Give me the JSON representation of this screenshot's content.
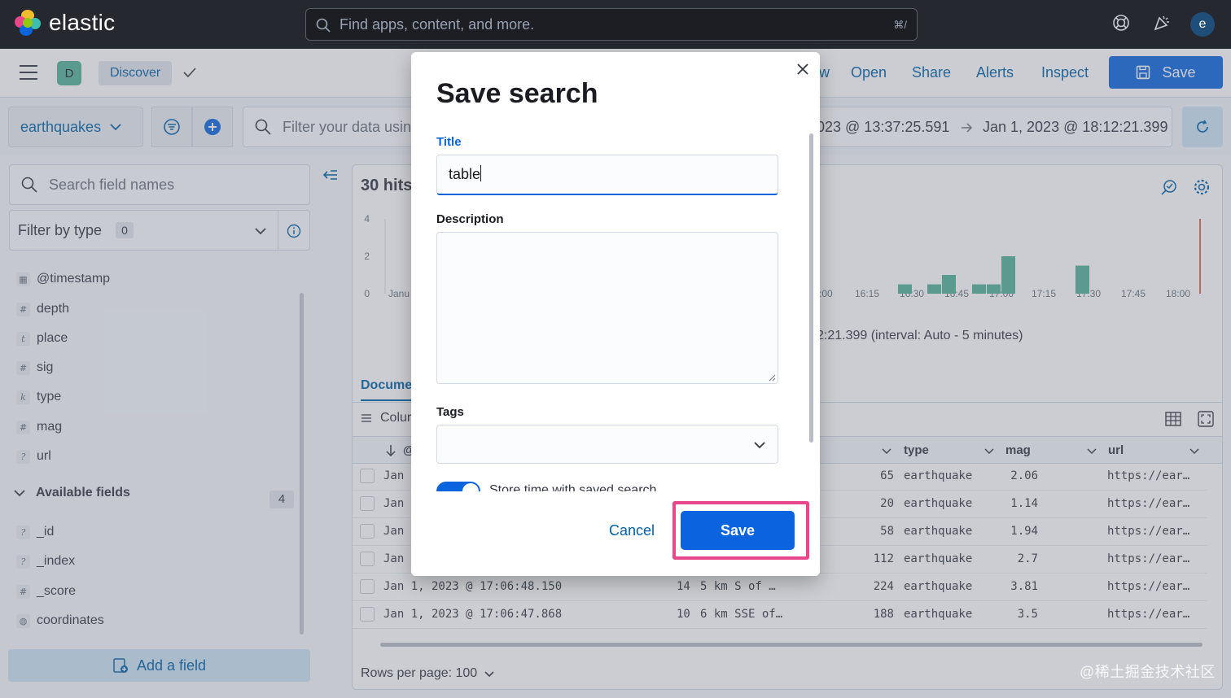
{
  "header": {
    "brand": "elastic",
    "search_placeholder": "Find apps, content, and more.",
    "search_shortcut": "⌘/",
    "avatar_initial": "e"
  },
  "appbar": {
    "space_initial": "D",
    "breadcrumb": "Discover",
    "menu": [
      "w",
      "Open",
      "Share",
      "Alerts",
      "Inspect"
    ],
    "save_label": "Save"
  },
  "querybar": {
    "data_view": "earthquakes",
    "filter_placeholder": "Filter your data usin",
    "date_start": "023 @ 13:37:25.591",
    "date_end": "Jan 1, 2023 @ 18:12:21.399"
  },
  "sidebar": {
    "search_placeholder": "Search field names",
    "filter_by_type": "Filter by type",
    "filter_count": "0",
    "selected_fields": [
      {
        "name": "@timestamp",
        "type": "date"
      },
      {
        "name": "depth",
        "type": "#"
      },
      {
        "name": "place",
        "type": "t"
      },
      {
        "name": "sig",
        "type": "#"
      },
      {
        "name": "type",
        "type": "k"
      },
      {
        "name": "mag",
        "type": "#"
      },
      {
        "name": "url",
        "type": "?"
      }
    ],
    "available_label": "Available fields",
    "available_count": "4",
    "available_fields": [
      {
        "name": "_id",
        "type": "?"
      },
      {
        "name": "_index",
        "type": "?"
      },
      {
        "name": "_score",
        "type": "#"
      },
      {
        "name": "coordinates",
        "type": "geo"
      }
    ],
    "add_field": "Add a field"
  },
  "main": {
    "hits": "30 hits",
    "interval_text": "2:21.399 (interval: Auto - 5 minutes)",
    "tab_documents": "Docume",
    "columns_label": "Colur",
    "grid_headers": [
      "type",
      "mag",
      "url"
    ],
    "rows_per_page": "Rows per page: 100",
    "rows": [
      {
        "ts": "Jan",
        "place": "",
        "sig": "65",
        "type": "earthquake",
        "mag": "2.06",
        "url": "https://ear…"
      },
      {
        "ts": "Jan",
        "place": "",
        "sig": "20",
        "type": "earthquake",
        "mag": "1.14",
        "url": "https://ear…"
      },
      {
        "ts": "Jan",
        "place": "",
        "sig": "58",
        "type": "earthquake",
        "mag": "1.94",
        "url": "https://ear…"
      },
      {
        "ts": "Jan",
        "place": "",
        "sig": "112",
        "type": "earthquake",
        "mag": "2.7",
        "url": "https://ear…"
      },
      {
        "ts": "Jan 1, 2023 @ 17:06:48.150",
        "depth": "14",
        "place": "5 km S of …",
        "sig": "224",
        "type": "earthquake",
        "mag": "3.81",
        "url": "https://ear…"
      },
      {
        "ts": "Jan 1, 2023 @ 17:06:47.868",
        "depth": "10",
        "place": "6 km SSE of…",
        "sig": "188",
        "type": "earthquake",
        "mag": "3.5",
        "url": "https://ear…"
      }
    ]
  },
  "chart_data": {
    "type": "bar",
    "yticks": [
      "4",
      "2",
      "0"
    ],
    "ylim": [
      0,
      4
    ],
    "xticks": [
      "Janu",
      ":00",
      "16:15",
      "16:30",
      "16:45",
      "17:00",
      "17:15",
      "17:30",
      "17:45",
      "18:00"
    ],
    "bars": [
      {
        "x": "16:25",
        "value": 0.5
      },
      {
        "x": "16:35",
        "value": 0.5
      },
      {
        "x": "16:40",
        "value": 1
      },
      {
        "x": "16:50",
        "value": 0.5
      },
      {
        "x": "16:55",
        "value": 0.5
      },
      {
        "x": "17:00",
        "value": 2
      },
      {
        "x": "17:25",
        "value": 1.5
      }
    ],
    "bar_color": "#54b399"
  },
  "modal": {
    "title": "Save search",
    "title_label": "Title",
    "title_value": "table",
    "description_label": "Description",
    "tags_label": "Tags",
    "toggle_label": "Store time with saved search",
    "cancel": "Cancel",
    "save": "Save"
  },
  "watermark": "@稀土掘金技术社区",
  "colors": {
    "accent": "#0b64dd",
    "highlight": "#e8488b",
    "header_bg": "#25282f"
  }
}
